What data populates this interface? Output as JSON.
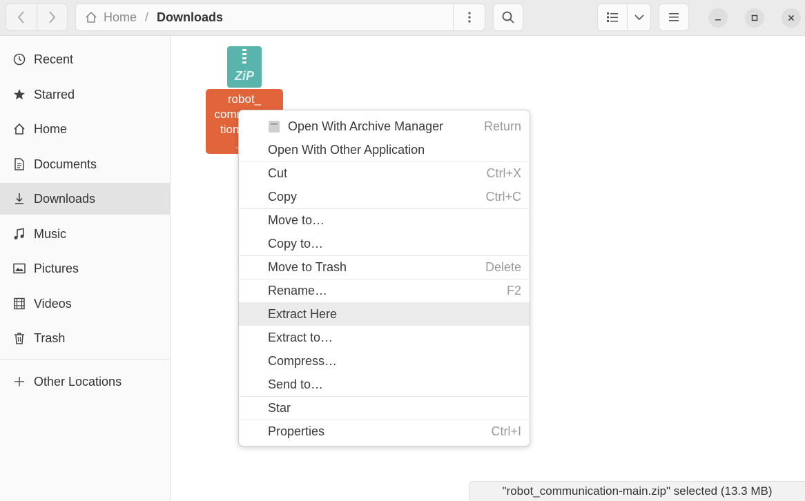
{
  "pathbar": {
    "home_label": "Home",
    "separator": "/",
    "current": "Downloads"
  },
  "sidebar": {
    "items": [
      {
        "label": "Recent",
        "icon": "clock-icon"
      },
      {
        "label": "Starred",
        "icon": "star-icon"
      },
      {
        "label": "Home",
        "icon": "home-icon"
      },
      {
        "label": "Documents",
        "icon": "document-icon"
      },
      {
        "label": "Downloads",
        "icon": "download-icon",
        "active": true
      },
      {
        "label": "Music",
        "icon": "music-icon"
      },
      {
        "label": "Pictures",
        "icon": "picture-icon"
      },
      {
        "label": "Videos",
        "icon": "video-icon"
      },
      {
        "label": "Trash",
        "icon": "trash-icon"
      }
    ],
    "other_locations": "Other Locations"
  },
  "file": {
    "icon_text": "ZiP",
    "label": "robot_\ncommunica\ntion-main\n.zip"
  },
  "context_menu": {
    "items": [
      {
        "label": "Open With Archive Manager",
        "accel": "Return"
      },
      {
        "label": "Open With Other Application",
        "accel": ""
      },
      {
        "label": "Cut",
        "accel": "Ctrl+X"
      },
      {
        "label": "Copy",
        "accel": "Ctrl+C"
      },
      {
        "label": "Move to…",
        "accel": ""
      },
      {
        "label": "Copy to…",
        "accel": ""
      },
      {
        "label": "Move to Trash",
        "accel": "Delete"
      },
      {
        "label": "Rename…",
        "accel": "F2"
      },
      {
        "label": "Extract Here",
        "accel": "",
        "highlighted": true
      },
      {
        "label": "Extract to…",
        "accel": ""
      },
      {
        "label": "Compress…",
        "accel": ""
      },
      {
        "label": "Send to…",
        "accel": ""
      },
      {
        "label": "Star",
        "accel": ""
      },
      {
        "label": "Properties",
        "accel": "Ctrl+I"
      }
    ]
  },
  "status": {
    "text": "\"robot_communication-main.zip\" selected  (13.3 MB)"
  },
  "colors": {
    "selection": "#e2643a",
    "zip_icon": "#59b5ac",
    "active_sidebar": "#e3e3e3"
  }
}
